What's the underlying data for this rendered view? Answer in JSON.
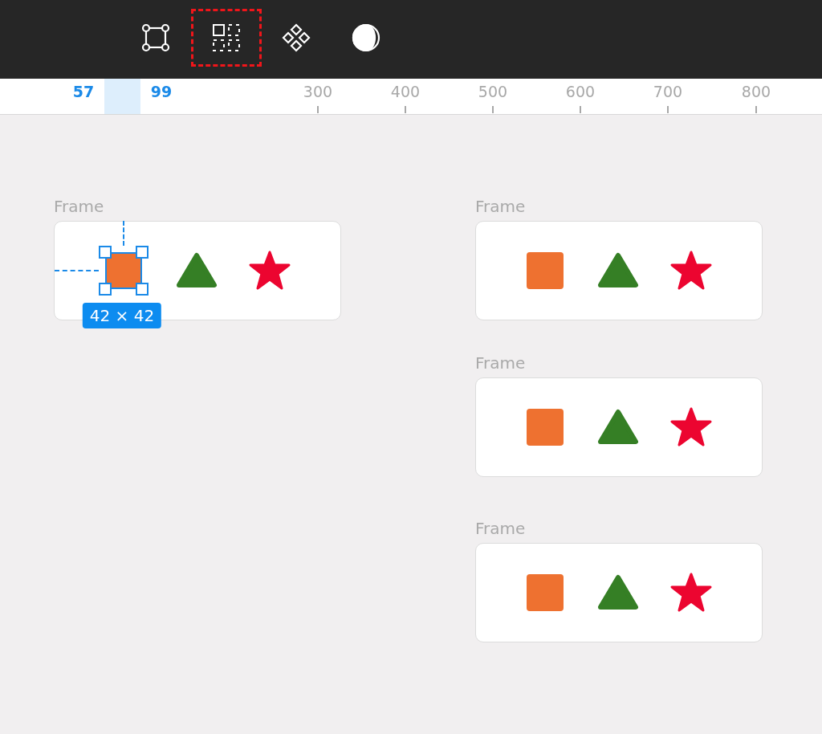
{
  "toolbar": {
    "tools": [
      {
        "kind": "frame",
        "selected": false
      },
      {
        "kind": "layout-grid",
        "selected": true
      },
      {
        "kind": "components",
        "selected": false
      },
      {
        "kind": "contrast",
        "selected": false
      }
    ]
  },
  "ruler": {
    "marks": [
      {
        "label": "57",
        "kind": "selection"
      },
      {
        "label": "99",
        "kind": "selection"
      },
      {
        "label": "300",
        "kind": "tick"
      },
      {
        "label": "400",
        "kind": "tick"
      },
      {
        "label": "500",
        "kind": "tick"
      },
      {
        "label": "600",
        "kind": "tick"
      },
      {
        "label": "700",
        "kind": "tick"
      },
      {
        "label": "800",
        "kind": "tick"
      }
    ]
  },
  "frames": [
    {
      "label": "Frame",
      "shapes": [
        {
          "kind": "square",
          "color": "#ee7130",
          "selected": true,
          "size": "42 × 42"
        },
        {
          "kind": "triangle",
          "color": "#357f25",
          "selected": false
        },
        {
          "kind": "star",
          "color": "#ec0530",
          "selected": false
        }
      ]
    },
    {
      "label": "Frame",
      "shapes": [
        {
          "kind": "square",
          "color": "#ee7130",
          "selected": false
        },
        {
          "kind": "triangle",
          "color": "#357f25",
          "selected": false
        },
        {
          "kind": "star",
          "color": "#ec0530",
          "selected": false
        }
      ]
    },
    {
      "label": "Frame",
      "shapes": [
        {
          "kind": "square",
          "color": "#ee7130",
          "selected": false
        },
        {
          "kind": "triangle",
          "color": "#357f25",
          "selected": false
        },
        {
          "kind": "star",
          "color": "#ec0530",
          "selected": false
        }
      ]
    },
    {
      "label": "Frame",
      "shapes": [
        {
          "kind": "square",
          "color": "#ee7130",
          "selected": false
        },
        {
          "kind": "triangle",
          "color": "#357f25",
          "selected": false
        },
        {
          "kind": "star",
          "color": "#ec0530",
          "selected": false
        }
      ]
    }
  ]
}
